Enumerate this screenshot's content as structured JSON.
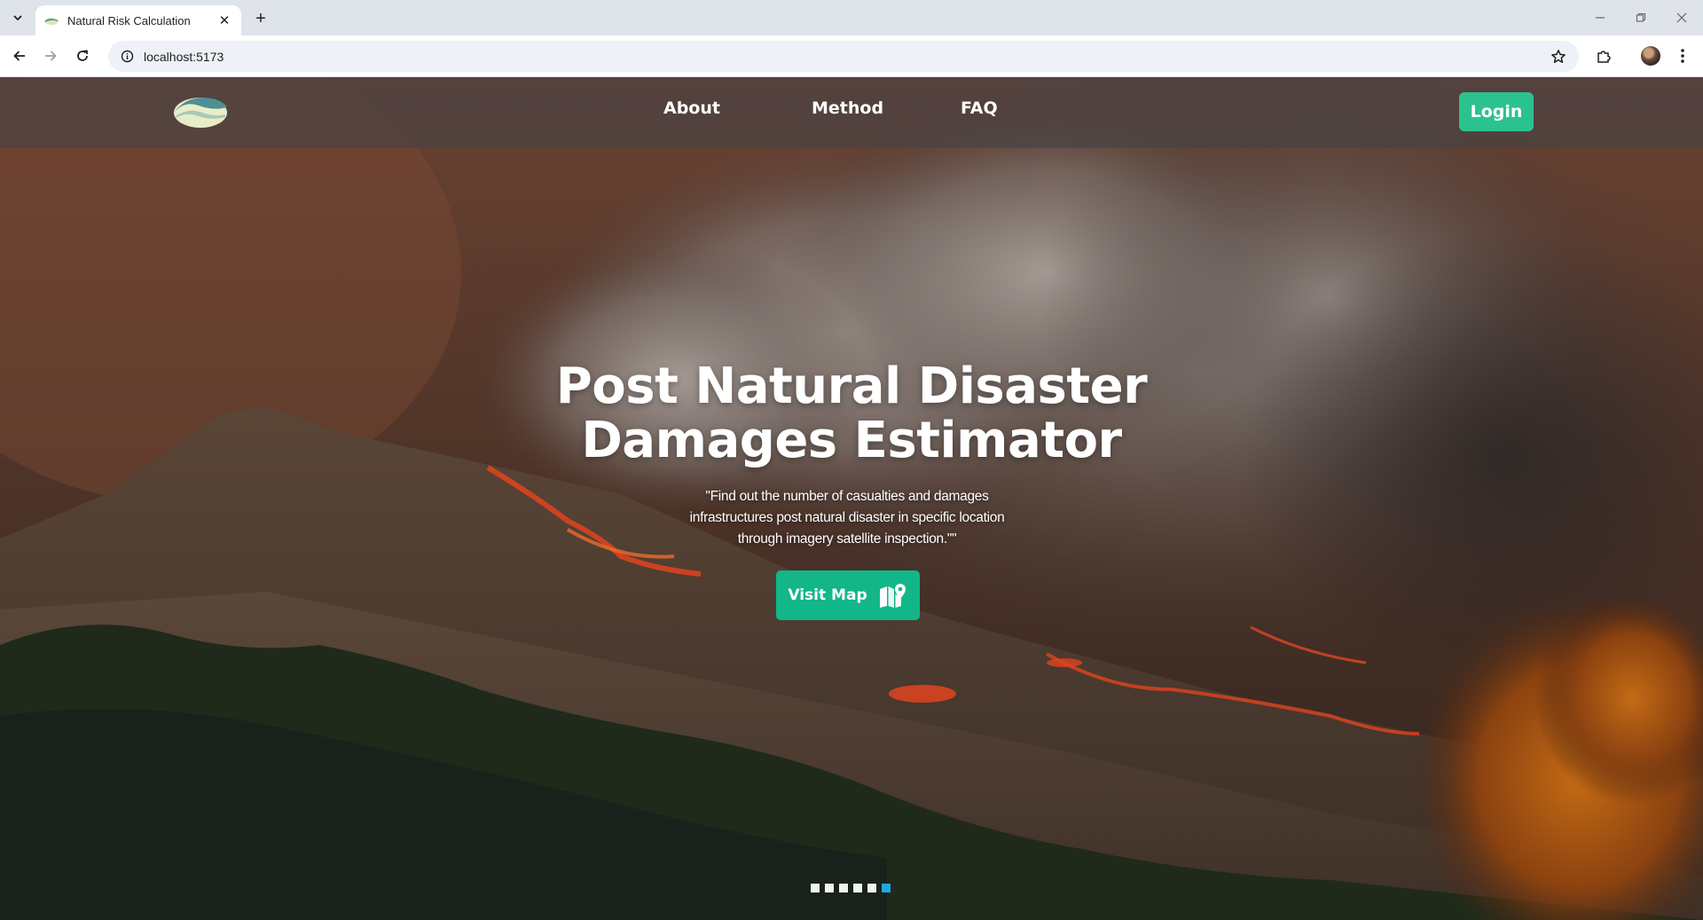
{
  "browser": {
    "tab_title": "Natural Risk Calculation",
    "url": "localhost:5173"
  },
  "nav": {
    "links": [
      "About",
      "Method",
      "FAQ"
    ],
    "login_label": "Login"
  },
  "hero": {
    "headline_line1": "Post Natural Disaster",
    "headline_line2": "Damages Estimator",
    "subtitle": "\"Find out the number of casualties and damages infrastructures post natural disaster in specific location through imagery satellite inspection.\"\"",
    "cta_label": "Visit Map"
  },
  "carousel": {
    "slide_count": 6,
    "active_index": 5
  },
  "colors": {
    "accent": "#2bc28f",
    "cta": "#13b688",
    "active_dot": "#1ea7e6"
  }
}
